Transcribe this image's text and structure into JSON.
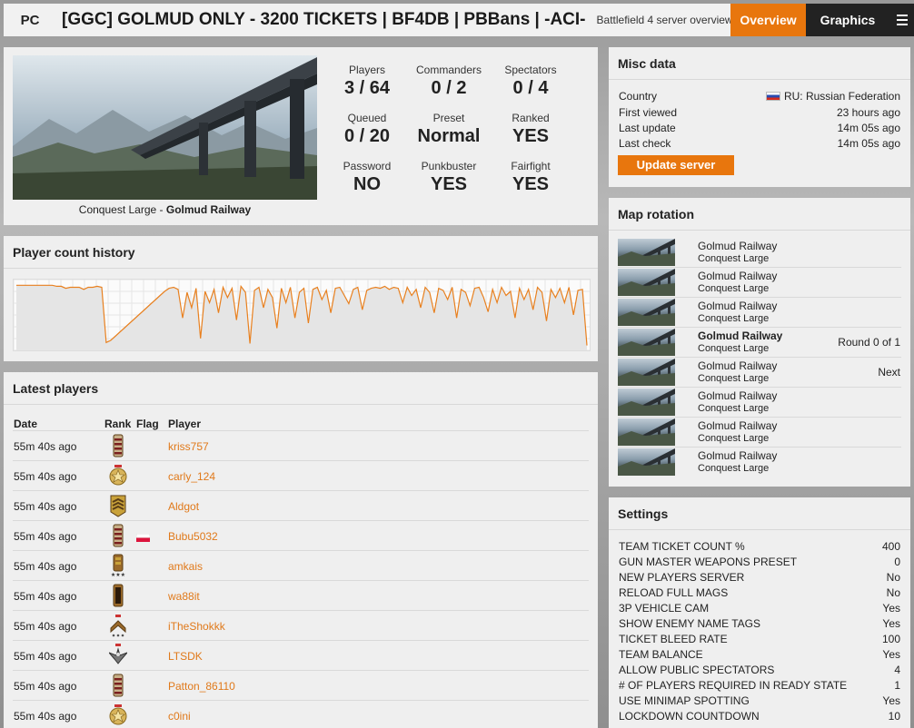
{
  "header": {
    "platform": "PC",
    "server_name": "[GGC] GOLMUD ONLY - 3200 TICKETS | BF4DB | PBBans | -ACI-",
    "subtitle": "Battlefield 4 server overview",
    "tabs": {
      "overview": "Overview",
      "graphics": "Graphics"
    },
    "menu_icon": "hamburger-icon",
    "accent_color": "#e8760d"
  },
  "server": {
    "map_mode": "Conquest Large",
    "caption_sep": " - ",
    "map_name": "Golmud Railway",
    "stats": [
      {
        "label": "Players",
        "value": "3 / 64"
      },
      {
        "label": "Commanders",
        "value": "0 / 2"
      },
      {
        "label": "Spectators",
        "value": "0 / 4"
      },
      {
        "label": "Queued",
        "value": "0 / 20"
      },
      {
        "label": "Preset",
        "value": "Normal"
      },
      {
        "label": "Ranked",
        "value": "YES"
      },
      {
        "label": "Password",
        "value": "NO"
      },
      {
        "label": "Punkbuster",
        "value": "YES"
      },
      {
        "label": "Fairfight",
        "value": "YES"
      }
    ]
  },
  "history": {
    "title": "Player count history",
    "line_color": "#e8801f",
    "chart_data": {
      "type": "line",
      "ylim": [
        0,
        64
      ],
      "grid": true,
      "values": [
        62,
        62,
        62,
        62,
        62,
        62,
        62,
        62,
        62,
        61,
        61,
        59,
        60,
        60,
        60,
        58,
        60,
        60,
        61,
        60,
        6,
        8,
        12,
        16,
        20,
        24,
        28,
        32,
        36,
        40,
        44,
        48,
        52,
        56,
        59,
        60,
        58,
        30,
        55,
        40,
        59,
        10,
        56,
        45,
        58,
        35,
        60,
        50,
        59,
        28,
        61,
        55,
        5,
        57,
        60,
        40,
        58,
        50,
        20,
        59,
        45,
        60,
        30,
        55,
        59,
        25,
        58,
        60,
        48,
        57,
        35,
        59,
        60,
        52,
        44,
        58,
        60,
        38,
        57,
        59,
        60,
        59,
        61,
        58,
        60,
        59,
        45,
        60,
        52,
        58,
        40,
        60,
        55,
        35,
        59,
        57,
        48,
        60,
        30,
        58,
        55,
        42,
        59,
        60,
        50,
        36,
        58,
        45,
        60,
        52,
        56,
        30,
        59,
        48,
        58,
        38,
        60,
        55,
        27,
        58,
        50,
        59,
        45,
        60,
        33,
        57,
        58,
        3
      ]
    }
  },
  "players": {
    "title": "Latest players",
    "columns": {
      "date": "Date",
      "rank": "Rank",
      "flag": "Flag",
      "player": "Player"
    },
    "rows": [
      {
        "date": "55m 40s ago",
        "rank_icon": "rank-bars-icon",
        "flag": "",
        "name": "kriss757"
      },
      {
        "date": "55m 40s ago",
        "rank_icon": "rank-star-icon",
        "flag": "",
        "name": "carly_124"
      },
      {
        "date": "55m 40s ago",
        "rank_icon": "rank-chevron-shield-icon",
        "flag": "",
        "name": "Aldgot"
      },
      {
        "date": "55m 40s ago",
        "rank_icon": "rank-bars-icon",
        "flag": "PL",
        "name": "Bubu5032"
      },
      {
        "date": "55m 40s ago",
        "rank_icon": "rank-bars-stars-icon",
        "flag": "",
        "name": "amkais"
      },
      {
        "date": "55m 40s ago",
        "rank_icon": "rank-bar-icon",
        "flag": "",
        "name": "wa88it"
      },
      {
        "date": "55m 40s ago",
        "rank_icon": "rank-chevron-icon",
        "flag": "",
        "name": "iTheShokkk"
      },
      {
        "date": "55m 40s ago",
        "rank_icon": "rank-eagle-icon",
        "flag": "",
        "name": "LTSDK"
      },
      {
        "date": "55m 40s ago",
        "rank_icon": "rank-bars-icon",
        "flag": "",
        "name": "Patton_86110"
      },
      {
        "date": "55m 40s ago",
        "rank_icon": "rank-star-icon",
        "flag": "",
        "name": "c0ini"
      }
    ]
  },
  "misc": {
    "title": "Misc data",
    "rows": [
      {
        "label": "Country",
        "value": "RU: Russian Federation"
      },
      {
        "label": "First viewed",
        "value": "23 hours ago"
      },
      {
        "label": "Last update",
        "value": "14m 05s ago"
      },
      {
        "label": "Last check",
        "value": "14m 05s ago"
      }
    ],
    "button": "Update server"
  },
  "rotation": {
    "title": "Map rotation",
    "rows": [
      {
        "map": "Golmud Railway",
        "mode": "Conquest Large",
        "status": ""
      },
      {
        "map": "Golmud Railway",
        "mode": "Conquest Large",
        "status": ""
      },
      {
        "map": "Golmud Railway",
        "mode": "Conquest Large",
        "status": ""
      },
      {
        "map": "Golmud Railway",
        "mode": "Conquest Large",
        "status": "Round 0 of 1"
      },
      {
        "map": "Golmud Railway",
        "mode": "Conquest Large",
        "status": "Next"
      },
      {
        "map": "Golmud Railway",
        "mode": "Conquest Large",
        "status": ""
      },
      {
        "map": "Golmud Railway",
        "mode": "Conquest Large",
        "status": ""
      },
      {
        "map": "Golmud Railway",
        "mode": "Conquest Large",
        "status": ""
      }
    ]
  },
  "settings": {
    "title": "Settings",
    "rows": [
      {
        "label": "TEAM TICKET COUNT %",
        "value": "400"
      },
      {
        "label": "GUN MASTER WEAPONS PRESET",
        "value": "0"
      },
      {
        "label": "NEW PLAYERS SERVER",
        "value": "No"
      },
      {
        "label": "RELOAD FULL MAGS",
        "value": "No"
      },
      {
        "label": "3P VEHICLE CAM",
        "value": "Yes"
      },
      {
        "label": "SHOW ENEMY NAME TAGS",
        "value": "Yes"
      },
      {
        "label": "TICKET BLEED RATE",
        "value": "100"
      },
      {
        "label": "TEAM BALANCE",
        "value": "Yes"
      },
      {
        "label": "ALLOW PUBLIC SPECTATORS",
        "value": "4"
      },
      {
        "label": "# OF PLAYERS REQUIRED IN READY STATE",
        "value": "1"
      },
      {
        "label": "USE MINIMAP SPOTTING",
        "value": "Yes"
      },
      {
        "label": "LOCKDOWN COUNTDOWN",
        "value": "10"
      }
    ]
  }
}
